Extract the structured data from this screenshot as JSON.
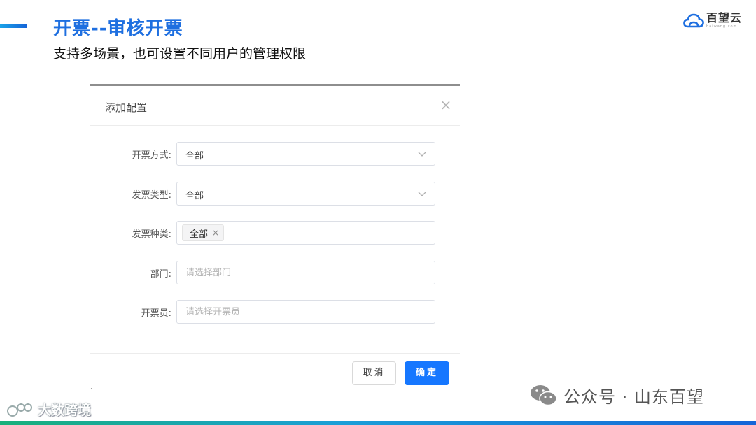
{
  "slide": {
    "title": "开票--审核开票",
    "subtitle": "支持多场景，也可设置不同用户的管理权限"
  },
  "logo": {
    "name": "百望云",
    "sub": "baiwang.com"
  },
  "dialog": {
    "title": "添加配置",
    "close_symbol": "×",
    "fields": [
      {
        "label": "开票方式:",
        "value": "全部"
      },
      {
        "label": "发票类型:",
        "value": "全部"
      },
      {
        "label": "发票种类:",
        "tag": "全部",
        "tag_close": "×"
      },
      {
        "label": "部门:",
        "placeholder": "请选择部门",
        "value": ""
      },
      {
        "label": "开票员:",
        "placeholder": "请选择开票员",
        "value": ""
      }
    ],
    "cancel_label": "取消",
    "ok_label": "确定"
  },
  "watermarks": {
    "left": "大数跨境",
    "right": "公众号 · 山东百望"
  },
  "icons": {
    "close": "close-icon",
    "chevron": "chevron-down-icon",
    "logo": "cloud-logo-icon",
    "wechat": "wechat-icon"
  },
  "colors": {
    "title": "#1e6fe0",
    "primary_button": "#1677ff",
    "border": "#dcdfe6"
  }
}
